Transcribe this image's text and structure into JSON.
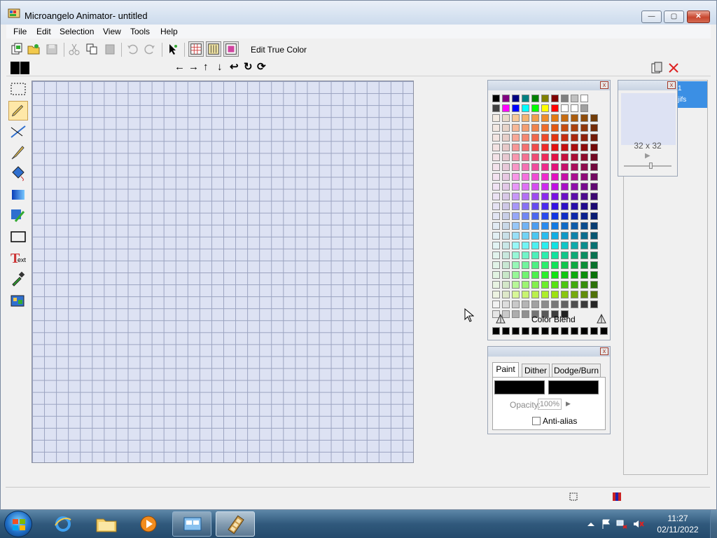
{
  "window": {
    "title": "Microangelo Animator- untitled",
    "min_glyph": "—",
    "max_glyph": "▢",
    "close_glyph": "✕"
  },
  "menu": [
    "File",
    "Edit",
    "Selection",
    "View",
    "Tools",
    "Help"
  ],
  "toolbar": {
    "edit_true_color": "Edit True Color"
  },
  "arrows": [
    "←",
    "→",
    "↑",
    "↓",
    "↩",
    "↻",
    "⟳"
  ],
  "tools": [
    "select-rect",
    "pencil",
    "line",
    "brush",
    "fill",
    "gradient",
    "color-replace",
    "rectangle",
    "text",
    "eyedropper",
    "effects"
  ],
  "palette_panel": {
    "close_glyph": "x",
    "color_blend": "Color Blend"
  },
  "paint_panel": {
    "close_glyph": "x",
    "tabs": [
      "Paint",
      "Dither",
      "Dodge/Burn"
    ],
    "opacity_label": "Opacity:",
    "opacity_value": "100%",
    "anti_alias": "Anti-alias"
  },
  "frame_panel": {
    "close_glyph": "x",
    "size": "32 x 32",
    "play_glyph": "▶",
    "selected_number": "1",
    "selected_label": "jifs"
  },
  "taskbar": {
    "time": "11:27",
    "date": "02/11/2022"
  },
  "colors": {
    "canvas_bg": "#dde2f3",
    "grid": "#9aa3c0",
    "selection": "#3b8fe4"
  }
}
